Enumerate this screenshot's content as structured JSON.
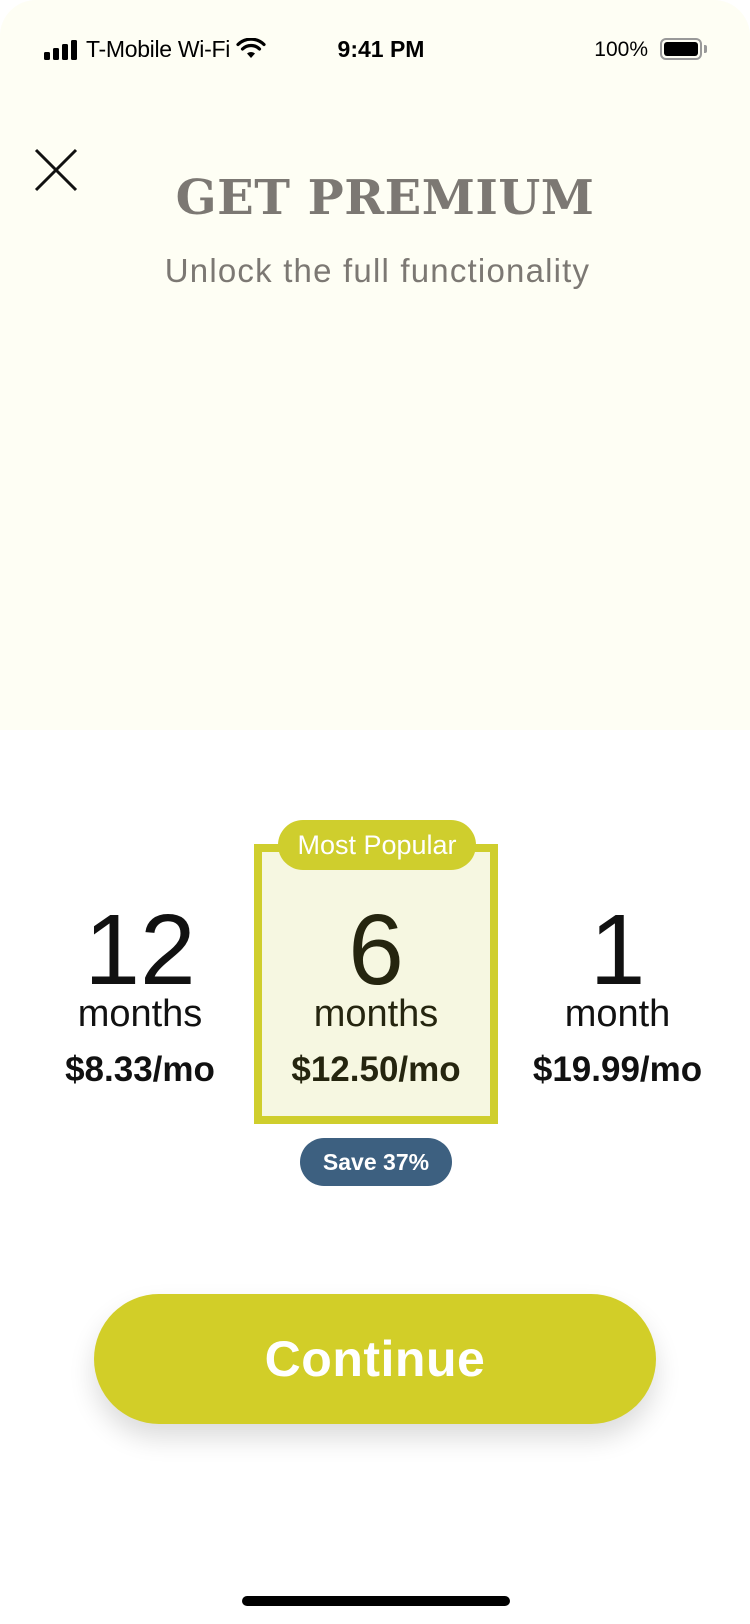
{
  "status_bar": {
    "carrier": "T-Mobile Wi-Fi",
    "time": "9:41 PM",
    "battery_percent": "100%",
    "battery_level": 1.0,
    "icons": [
      "signal-icon",
      "wifi-icon",
      "battery-icon"
    ]
  },
  "header": {
    "close_icon": "close-icon",
    "title": "GET PREMIUM",
    "subtitle": "Unlock the full functionality"
  },
  "plans": [
    {
      "count": "12",
      "unit": "months",
      "price": "$8.33/mo"
    },
    {
      "count": "6",
      "unit": "months",
      "price": "$12.50/mo",
      "selected": true,
      "badge": "Most Popular",
      "savings": "Save 37%"
    },
    {
      "count": "1",
      "unit": "month",
      "price": "$19.99/mo"
    }
  ],
  "continue_label": "Continue",
  "colors": {
    "hero_background": "#fefef4",
    "accent": "#d2ce28",
    "selected_plan_background": "#f6f7e1",
    "savings_badge": "#3d6080",
    "title_text": "#7c7873"
  }
}
